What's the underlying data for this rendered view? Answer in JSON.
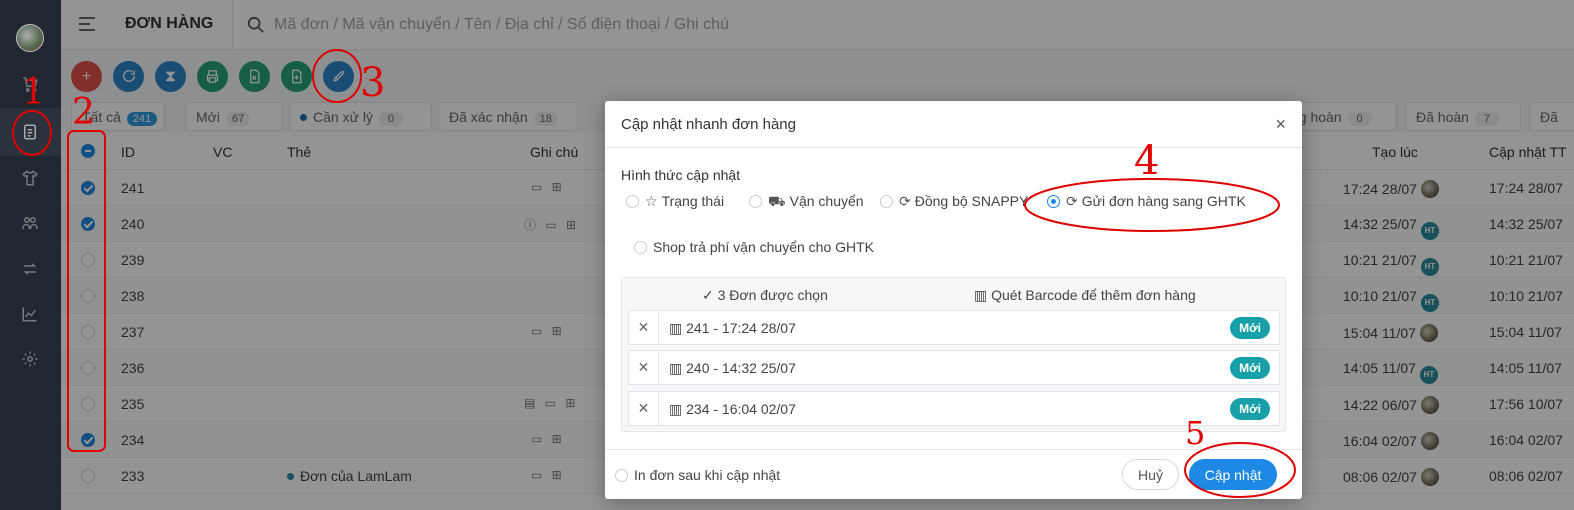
{
  "sidebar": {
    "items": [
      "user-avatar",
      "cart-icon",
      "orders-icon",
      "shirt-icon",
      "customers-icon",
      "transfer-icon",
      "chart-icon",
      "settings-icon"
    ]
  },
  "header": {
    "title": "ĐƠN HÀNG",
    "search_placeholder": "Mã đơn / Mã vận chuyển / Tên / Địa chỉ / Số điện thoại / Ghi chú"
  },
  "actions": [
    {
      "icon": "plus-icon",
      "color": "#e0524a"
    },
    {
      "icon": "refresh-icon",
      "color": "#2e86c9"
    },
    {
      "icon": "hourglass-icon",
      "color": "#2e86c9"
    },
    {
      "icon": "print-icon",
      "color": "#27a37c"
    },
    {
      "icon": "excel-icon",
      "color": "#27a37c"
    },
    {
      "icon": "file-add-icon",
      "color": "#27a37c"
    },
    {
      "icon": "rocket-icon",
      "color": "#2e86c9"
    }
  ],
  "tabs": [
    {
      "label": "Tất cả",
      "count": "241"
    },
    {
      "label": "Mới",
      "count": "67"
    },
    {
      "label": "Cần xử lý",
      "count": "0"
    },
    {
      "label": "Đã xác nhận",
      "count": "18"
    },
    {
      "label": "ng hoàn",
      "count": "0"
    },
    {
      "label": "Đã hoàn",
      "count": "7"
    },
    {
      "label": "Đã"
    }
  ],
  "table": {
    "headers": {
      "id": "ID",
      "vc": "VC",
      "tag": "Thẻ",
      "note": "Ghi chú",
      "created": "Tạo lúc",
      "updated": "Cập nhật TT"
    },
    "rows": [
      {
        "id": "241",
        "checked": true,
        "notes": "▭ ⊞",
        "created": "17:24 28/07",
        "avatar": "pic",
        "updated": "17:24 28/07"
      },
      {
        "id": "240",
        "checked": true,
        "notes": "ⓘ ▭ ⊞",
        "created": "14:32 25/07",
        "avatar": "HT",
        "updated": "14:32 25/07"
      },
      {
        "id": "239",
        "checked": false,
        "notes": "",
        "created": "10:21 21/07",
        "avatar": "HT",
        "updated": "10:21 21/07"
      },
      {
        "id": "238",
        "checked": false,
        "notes": "",
        "created": "10:10 21/07",
        "avatar": "HT",
        "updated": "10:10 21/07"
      },
      {
        "id": "237",
        "checked": false,
        "notes": "▭ ⊞",
        "created": "15:04 11/07",
        "avatar": "pic",
        "updated": "15:04 11/07"
      },
      {
        "id": "236",
        "checked": false,
        "notes": "",
        "created": "14:05 11/07",
        "avatar": "HT",
        "updated": "14:05 11/07"
      },
      {
        "id": "235",
        "checked": false,
        "notes": "▤ ▭ ⊞",
        "created": "14:22 06/07",
        "avatar": "pic",
        "updated": "17:56 10/07"
      },
      {
        "id": "234",
        "checked": true,
        "notes": "▭ ⊞",
        "created": "16:04 02/07",
        "avatar": "pic",
        "updated": "16:04 02/07"
      },
      {
        "id": "233",
        "checked": false,
        "tag": "Đơn của LamLam",
        "notes": "▭ ⊞",
        "created": "08:06 02/07",
        "avatar": "pic",
        "updated": "08:06 02/07"
      }
    ]
  },
  "modal": {
    "title": "Cập nhật nhanh đơn hàng",
    "close": "×",
    "method_label": "Hình thức cập nhật",
    "options": [
      {
        "label": "Trạng thái",
        "icon": "star-icon",
        "selected": false
      },
      {
        "label": "Vận chuyển",
        "icon": "car-icon",
        "selected": false
      },
      {
        "label": "Đồng bộ SNAPPY",
        "icon": "sync-icon",
        "selected": false
      },
      {
        "label": "Gửi đơn hàng sang GHTK",
        "icon": "sync-icon",
        "selected": true
      }
    ],
    "shop_pays": "Shop trả phí vận chuyển cho GHTK",
    "selected_header": "✓ 3 Đơn được chọn",
    "barcode_header": "Quét Barcode để thêm đơn hàng",
    "items": [
      {
        "text": "241 - 17:24 28/07",
        "status": "Mới"
      },
      {
        "text": "240 - 14:32 25/07",
        "status": "Mới"
      },
      {
        "text": "234 - 16:04 02/07",
        "status": "Mới"
      }
    ],
    "print_after": "In đơn sau khi cập nhật",
    "cancel": "Huỷ",
    "submit": "Cập nhật"
  },
  "annotations": [
    "1",
    "2",
    "3",
    "4",
    "5"
  ]
}
